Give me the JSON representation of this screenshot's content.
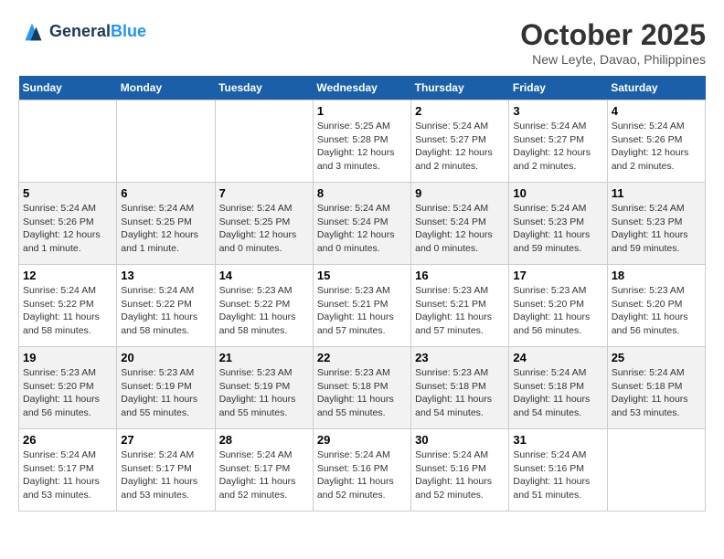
{
  "header": {
    "logo_line1": "General",
    "logo_line2": "Blue",
    "month": "October 2025",
    "location": "New Leyte, Davao, Philippines"
  },
  "weekdays": [
    "Sunday",
    "Monday",
    "Tuesday",
    "Wednesday",
    "Thursday",
    "Friday",
    "Saturday"
  ],
  "weeks": [
    [
      {
        "day": "",
        "info": ""
      },
      {
        "day": "",
        "info": ""
      },
      {
        "day": "",
        "info": ""
      },
      {
        "day": "1",
        "info": "Sunrise: 5:25 AM\nSunset: 5:28 PM\nDaylight: 12 hours and 3 minutes."
      },
      {
        "day": "2",
        "info": "Sunrise: 5:24 AM\nSunset: 5:27 PM\nDaylight: 12 hours and 2 minutes."
      },
      {
        "day": "3",
        "info": "Sunrise: 5:24 AM\nSunset: 5:27 PM\nDaylight: 12 hours and 2 minutes."
      },
      {
        "day": "4",
        "info": "Sunrise: 5:24 AM\nSunset: 5:26 PM\nDaylight: 12 hours and 2 minutes."
      }
    ],
    [
      {
        "day": "5",
        "info": "Sunrise: 5:24 AM\nSunset: 5:26 PM\nDaylight: 12 hours and 1 minute."
      },
      {
        "day": "6",
        "info": "Sunrise: 5:24 AM\nSunset: 5:25 PM\nDaylight: 12 hours and 1 minute."
      },
      {
        "day": "7",
        "info": "Sunrise: 5:24 AM\nSunset: 5:25 PM\nDaylight: 12 hours and 0 minutes."
      },
      {
        "day": "8",
        "info": "Sunrise: 5:24 AM\nSunset: 5:24 PM\nDaylight: 12 hours and 0 minutes."
      },
      {
        "day": "9",
        "info": "Sunrise: 5:24 AM\nSunset: 5:24 PM\nDaylight: 12 hours and 0 minutes."
      },
      {
        "day": "10",
        "info": "Sunrise: 5:24 AM\nSunset: 5:23 PM\nDaylight: 11 hours and 59 minutes."
      },
      {
        "day": "11",
        "info": "Sunrise: 5:24 AM\nSunset: 5:23 PM\nDaylight: 11 hours and 59 minutes."
      }
    ],
    [
      {
        "day": "12",
        "info": "Sunrise: 5:24 AM\nSunset: 5:22 PM\nDaylight: 11 hours and 58 minutes."
      },
      {
        "day": "13",
        "info": "Sunrise: 5:24 AM\nSunset: 5:22 PM\nDaylight: 11 hours and 58 minutes."
      },
      {
        "day": "14",
        "info": "Sunrise: 5:23 AM\nSunset: 5:22 PM\nDaylight: 11 hours and 58 minutes."
      },
      {
        "day": "15",
        "info": "Sunrise: 5:23 AM\nSunset: 5:21 PM\nDaylight: 11 hours and 57 minutes."
      },
      {
        "day": "16",
        "info": "Sunrise: 5:23 AM\nSunset: 5:21 PM\nDaylight: 11 hours and 57 minutes."
      },
      {
        "day": "17",
        "info": "Sunrise: 5:23 AM\nSunset: 5:20 PM\nDaylight: 11 hours and 56 minutes."
      },
      {
        "day": "18",
        "info": "Sunrise: 5:23 AM\nSunset: 5:20 PM\nDaylight: 11 hours and 56 minutes."
      }
    ],
    [
      {
        "day": "19",
        "info": "Sunrise: 5:23 AM\nSunset: 5:20 PM\nDaylight: 11 hours and 56 minutes."
      },
      {
        "day": "20",
        "info": "Sunrise: 5:23 AM\nSunset: 5:19 PM\nDaylight: 11 hours and 55 minutes."
      },
      {
        "day": "21",
        "info": "Sunrise: 5:23 AM\nSunset: 5:19 PM\nDaylight: 11 hours and 55 minutes."
      },
      {
        "day": "22",
        "info": "Sunrise: 5:23 AM\nSunset: 5:18 PM\nDaylight: 11 hours and 55 minutes."
      },
      {
        "day": "23",
        "info": "Sunrise: 5:23 AM\nSunset: 5:18 PM\nDaylight: 11 hours and 54 minutes."
      },
      {
        "day": "24",
        "info": "Sunrise: 5:24 AM\nSunset: 5:18 PM\nDaylight: 11 hours and 54 minutes."
      },
      {
        "day": "25",
        "info": "Sunrise: 5:24 AM\nSunset: 5:18 PM\nDaylight: 11 hours and 53 minutes."
      }
    ],
    [
      {
        "day": "26",
        "info": "Sunrise: 5:24 AM\nSunset: 5:17 PM\nDaylight: 11 hours and 53 minutes."
      },
      {
        "day": "27",
        "info": "Sunrise: 5:24 AM\nSunset: 5:17 PM\nDaylight: 11 hours and 53 minutes."
      },
      {
        "day": "28",
        "info": "Sunrise: 5:24 AM\nSunset: 5:17 PM\nDaylight: 11 hours and 52 minutes."
      },
      {
        "day": "29",
        "info": "Sunrise: 5:24 AM\nSunset: 5:16 PM\nDaylight: 11 hours and 52 minutes."
      },
      {
        "day": "30",
        "info": "Sunrise: 5:24 AM\nSunset: 5:16 PM\nDaylight: 11 hours and 52 minutes."
      },
      {
        "day": "31",
        "info": "Sunrise: 5:24 AM\nSunset: 5:16 PM\nDaylight: 11 hours and 51 minutes."
      },
      {
        "day": "",
        "info": ""
      }
    ]
  ]
}
